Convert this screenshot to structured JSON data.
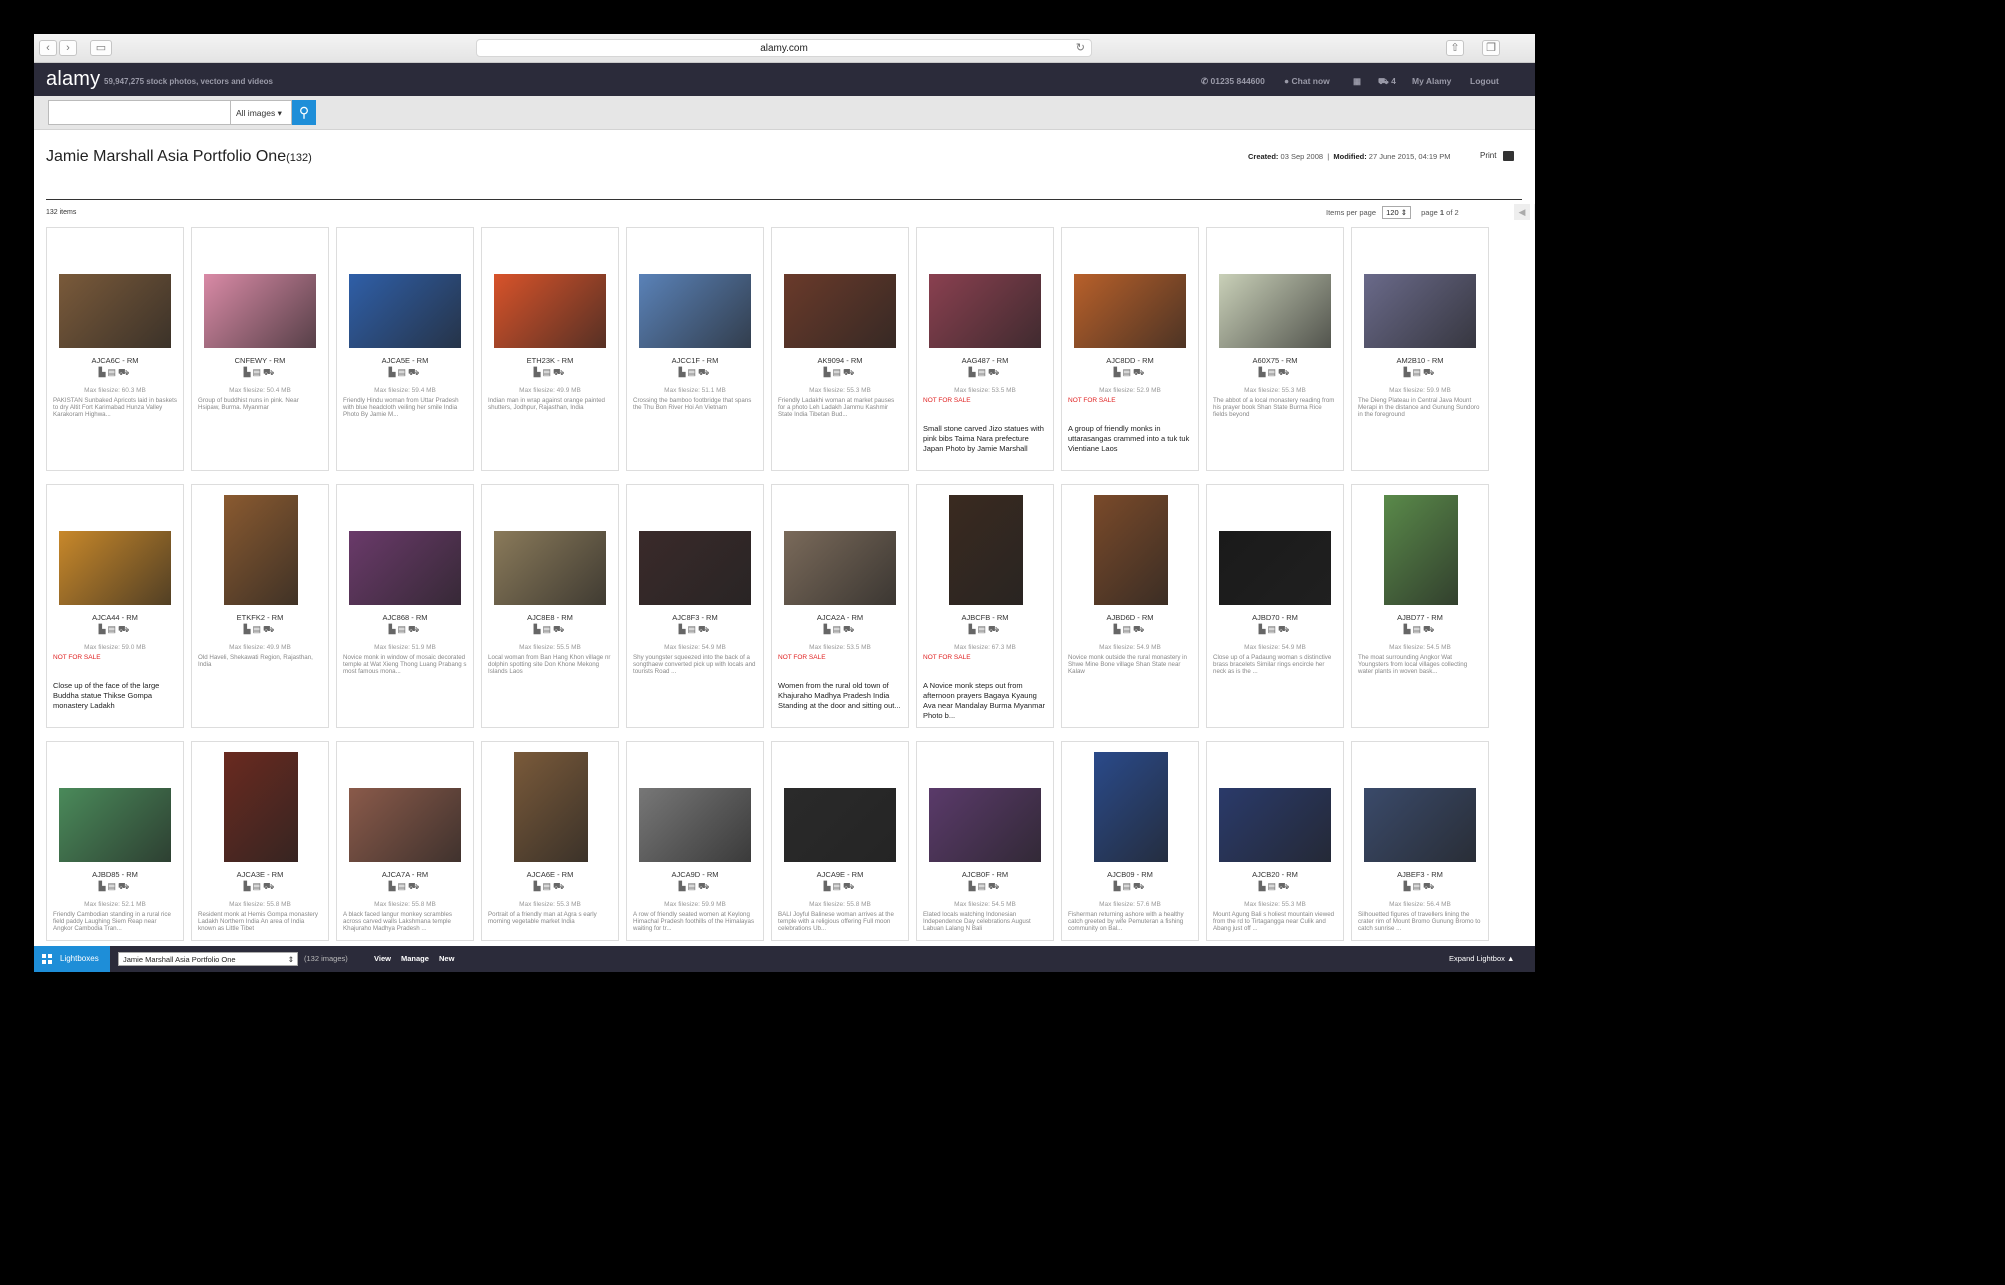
{
  "browser": {
    "url": "alamy.com"
  },
  "header": {
    "logo": "alamy",
    "count": "59,947,275",
    "tagline": "stock photos, vectors and videos",
    "phone": "01235 844600",
    "chat": "Chat now",
    "cart_count": "4",
    "my_alamy": "My Alamy",
    "logout": "Logout"
  },
  "search": {
    "placeholder": "",
    "scope": "All images"
  },
  "lightbox": {
    "title": "Jamie Marshall Asia Portfolio One",
    "count": "(132)",
    "created_label": "Created:",
    "created": "03 Sep 2008",
    "modified_label": "Modified:",
    "modified": "27 June 2015, 04:19 PM",
    "print": "Print",
    "items_count": "132 items",
    "items_per_page_label": "Items per page",
    "items_per_page": "120",
    "page_label": "page",
    "page": "1",
    "of_label": "of",
    "total_pages": "2"
  },
  "images": [
    {
      "code": "AJCA6C - RM",
      "size": "Max filesize: 60.3 MB",
      "desc": "PAKISTAN Sunbaked Apricots laid in baskets to dry Altit Fort Karimabad Hunza Valley Karakoram Highwa...",
      "nfs": "",
      "big": "",
      "portrait": false,
      "color": "#7a5a3a"
    },
    {
      "code": "CNFEWY - RM",
      "size": "Max filesize: 50.4 MB",
      "desc": "Group of buddhist nuns in pink. Near Hsipaw, Burma. Myanmar",
      "nfs": "",
      "big": "",
      "portrait": false,
      "color": "#d98aa6"
    },
    {
      "code": "AJCA5E - RM",
      "size": "Max filesize: 59.4 MB",
      "desc": "Friendly Hindu woman from Uttar Pradesh with blue headcloth veiling her smile India Photo By Jamie M...",
      "nfs": "",
      "big": "",
      "portrait": false,
      "color": "#2f5fa8"
    },
    {
      "code": "ETH23K - RM",
      "size": "Max filesize: 49.9 MB",
      "desc": "Indian man in wrap against orange painted shutters, Jodhpur, Rajasthan, India",
      "nfs": "",
      "big": "",
      "portrait": false,
      "color": "#d8532a"
    },
    {
      "code": "AJCC1F - RM",
      "size": "Max filesize: 51.1 MB",
      "desc": "Crossing the bamboo footbridge that spans the Thu Bon River Hoi An Vietnam",
      "nfs": "",
      "big": "",
      "portrait": false,
      "color": "#5a82b8"
    },
    {
      "code": "AK9094 - RM",
      "size": "Max filesize: 55.3 MB",
      "desc": "Friendly Ladakhi woman at market pauses for a photo Leh Ladakh Jammu Kashmir State India Tibetan Bud...",
      "nfs": "",
      "big": "",
      "portrait": false,
      "color": "#6a3a2a"
    },
    {
      "code": "AAG487 - RM",
      "size": "Max filesize: 53.5 MB",
      "desc": "",
      "nfs": "NOT FOR SALE",
      "big": "Small stone carved Jizo statues with pink bibs Taima Nara prefecture Japan Photo by Jamie Marshall",
      "portrait": false,
      "color": "#8a4050"
    },
    {
      "code": "AJC8DD - RM",
      "size": "Max filesize: 52.9 MB",
      "desc": "",
      "nfs": "NOT FOR SALE",
      "big": "A group of friendly monks in uttarasangas crammed into a tuk tuk Vientiane Laos",
      "portrait": false,
      "color": "#b8602a"
    },
    {
      "code": "A60X75 - RM",
      "size": "Max filesize: 55.3 MB",
      "desc": "The abbot of a local monastery reading from his prayer book Shan State Burma Rice fields beyond",
      "nfs": "",
      "big": "",
      "portrait": false,
      "color": "#c9d0b8"
    },
    {
      "code": "AM2B10 - RM",
      "size": "Max filesize: 59.9 MB",
      "desc": "The Dieng Plateau in Central Java Mount Merapi in the distance and Gunung Sundoro in the foreground",
      "nfs": "",
      "big": "",
      "portrait": false,
      "color": "#6a6a8a"
    },
    {
      "code": "AJCA44 - RM",
      "size": "Max filesize: 59.0 MB",
      "desc": "",
      "nfs": "NOT FOR SALE",
      "big": "Close up of the face of the large Buddha statue Thikse Gompa monastery Ladakh",
      "portrait": false,
      "color": "#c8882a"
    },
    {
      "code": "ETKFK2 - RM",
      "size": "Max filesize: 49.9 MB",
      "desc": "Old Haveli, Shekawati Region, Rajasthan, India",
      "nfs": "",
      "big": "",
      "portrait": true,
      "color": "#8a5a30"
    },
    {
      "code": "AJC868 - RM",
      "size": "Max filesize: 51.9 MB",
      "desc": "Novice monk in window of mosaic decorated temple at Wat Xieng Thong Luang Prabang s most famous mona...",
      "nfs": "",
      "big": "",
      "portrait": false,
      "color": "#6a3a6a"
    },
    {
      "code": "AJC8E8 - RM",
      "size": "Max filesize: 55.5 MB",
      "desc": "Local woman from Ban Hang Khon village nr dolphin spotting site Don Khone Mekong Islands Laos",
      "nfs": "",
      "big": "",
      "portrait": false,
      "color": "#8a7a5a"
    },
    {
      "code": "AJC8F3 - RM",
      "size": "Max filesize: 54.9 MB",
      "desc": "Shy youngster squeezed into the back of a songthaew converted pick up with locals and tourists Road ...",
      "nfs": "",
      "big": "",
      "portrait": false,
      "color": "#3a2a2a"
    },
    {
      "code": "AJCA2A - RM",
      "size": "Max filesize: 53.5 MB",
      "desc": "",
      "nfs": "NOT FOR SALE",
      "big": "Women from the rural old town of Khajuraho Madhya Pradesh India Standing at the door and sitting out...",
      "portrait": false,
      "color": "#7a6a5a"
    },
    {
      "code": "AJBCFB - RM",
      "size": "Max filesize: 67.3 MB",
      "desc": "",
      "nfs": "NOT FOR SALE",
      "big": "A Novice monk steps out from afternoon prayers Bagaya Kyaung Ava near Mandalay Burma Myanmar Photo b...",
      "portrait": true,
      "color": "#3a2a20"
    },
    {
      "code": "AJBD6D - RM",
      "size": "Max filesize: 54.9 MB",
      "desc": "Novice monk outside the rural monastery in Shwe Mine Bone village Shan State near Kalaw",
      "nfs": "",
      "big": "",
      "portrait": true,
      "color": "#7a4a2a"
    },
    {
      "code": "AJBD70 - RM",
      "size": "Max filesize: 54.9 MB",
      "desc": "Close up of a Padaung woman s distinctive brass bracelets Similar rings encircle her neck as is the ...",
      "nfs": "",
      "big": "",
      "portrait": false,
      "color": "#1a1a1a"
    },
    {
      "code": "AJBD77 - RM",
      "size": "Max filesize: 54.5 MB",
      "desc": "The moat surrounding Angkor Wat Youngsters from local villages collecting water plants in woven bask...",
      "nfs": "",
      "big": "",
      "portrait": true,
      "color": "#5a8a4a"
    },
    {
      "code": "AJBD85 - RM",
      "size": "Max filesize: 52.1 MB",
      "desc": "Friendly Cambodian standing in a rural rice field paddy Laughing Siem Reap near Angkor Cambodia Tran...",
      "nfs": "",
      "big": "",
      "portrait": false,
      "color": "#4a8a5a"
    },
    {
      "code": "AJCA3E - RM",
      "size": "Max filesize: 55.8 MB",
      "desc": "Resident monk at Hemis Gompa monastery Ladakh Northern India An area of India known as Little Tibet",
      "nfs": "",
      "big": "",
      "portrait": true,
      "color": "#6a2a20"
    },
    {
      "code": "AJCA7A - RM",
      "size": "Max filesize: 55.8 MB",
      "desc": "A black faced langur monkey scrambles across carved walls Lakshmana temple Khajuraho Madhya Pradesh ...",
      "nfs": "",
      "big": "",
      "portrait": false,
      "color": "#8a5a4a"
    },
    {
      "code": "AJCA6E - RM",
      "size": "Max filesize: 55.3 MB",
      "desc": "Portrait of a friendly man at Agra s early morning vegetable market India",
      "nfs": "",
      "big": "",
      "portrait": true,
      "color": "#7a5a3a"
    },
    {
      "code": "AJCA9D - RM",
      "size": "Max filesize: 59.9 MB",
      "desc": "A row of friendly seated women at Keylong Himachal Pradesh foothills of the Himalayas waiting for tr...",
      "nfs": "",
      "big": "",
      "portrait": false,
      "color": "#777777"
    },
    {
      "code": "AJCA9E - RM",
      "size": "Max filesize: 55.8 MB",
      "desc": "BALI Joyful Balinese woman arrives at the temple with a religious offering Full moon celebrations Ub...",
      "nfs": "",
      "big": "",
      "portrait": false,
      "color": "#2a2a2a"
    },
    {
      "code": "AJCB0F - RM",
      "size": "Max filesize: 54.5 MB",
      "desc": "Elated locals watching Indonesian Independence Day celebrations August Labuan Lalang N Bali",
      "nfs": "",
      "big": "",
      "portrait": false,
      "color": "#5a3a6a"
    },
    {
      "code": "AJCB09 - RM",
      "size": "Max filesize: 57.6 MB",
      "desc": "Fisherman returning ashore with a healthy catch greeted by wife Pemuteran a fishing community on Bal...",
      "nfs": "",
      "big": "",
      "portrait": true,
      "color": "#2a4a8a"
    },
    {
      "code": "AJCB20 - RM",
      "size": "Max filesize: 55.3 MB",
      "desc": "Mount Agung Bali s holiest mountain viewed from the rd to Tirtagangga near Culik and Abang just off ...",
      "nfs": "",
      "big": "",
      "portrait": false,
      "color": "#2a3a6a"
    },
    {
      "code": "AJBEF3 - RM",
      "size": "Max filesize: 56.4 MB",
      "desc": "Silhouetted figures of travellers lining the crater rim of Mount Bromo Gunung Bromo to catch sunrise ...",
      "nfs": "",
      "big": "",
      "portrait": false,
      "color": "#3a4a6a"
    }
  ],
  "bottom": {
    "lightboxes": "Lightboxes",
    "selected": "Jamie Marshall Asia Portfolio One",
    "count": "(132 images)",
    "view": "View",
    "manage": "Manage",
    "new": "New",
    "expand": "Expand Lightbox"
  }
}
